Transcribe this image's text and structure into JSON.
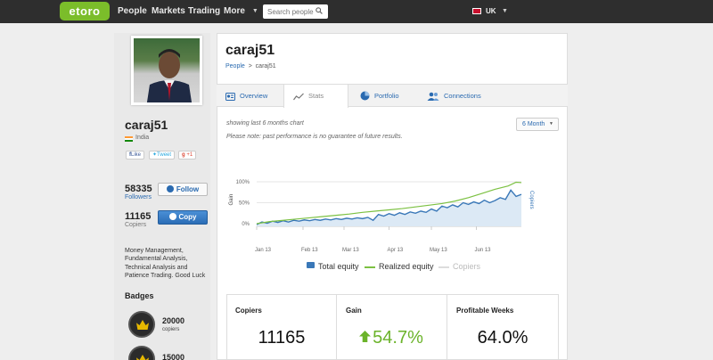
{
  "nav": {
    "logo": "etoro",
    "items": [
      "People",
      "Markets",
      "Trading",
      "More"
    ],
    "search_placeholder": "Search people",
    "language": "UK"
  },
  "profile": {
    "username": "caraj51",
    "country": "India",
    "social": {
      "facebook": "Like",
      "twitter": "Tweet",
      "gplus": "+1"
    },
    "followers_count": "58335",
    "followers_label": "Followers",
    "follow_label": "Follow",
    "copiers_count": "11165",
    "copiers_label": "Copiers",
    "copy_label": "Copy",
    "bio": "Money Management, Fundamental Analysis, Technical Analysis and Patience Trading. Good Luck",
    "badges_title": "Badges",
    "badges": [
      {
        "number": "20000",
        "label": "copiers"
      },
      {
        "number": "15000",
        "label": ""
      }
    ]
  },
  "main": {
    "title": "caraj51",
    "breadcrumb": {
      "root": "People",
      "sep": ">",
      "current": "caraj51"
    },
    "tabs": [
      "Overview",
      "Stats",
      "Portfolio",
      "Connections"
    ],
    "active_tab": "Stats",
    "note_period": "showing last 6 months chart",
    "note_disclaimer": "Please note: past performance is no guarantee of future results.",
    "period_select": "6 Month"
  },
  "chart_data": {
    "type": "line",
    "ylabel": "Gain",
    "y2label": "Copiers",
    "x_ticks": [
      "Jan 13",
      "Feb 13",
      "Mar 13",
      "Apr 13",
      "May 13",
      "Jun 13"
    ],
    "y_ticks": [
      "0%",
      "50%",
      "100%"
    ],
    "ylim": [
      0,
      100
    ],
    "legend_position": "bottom",
    "series": [
      {
        "name": "Total equity",
        "color": "#3a78b8",
        "style": "area",
        "x": [
          0,
          2,
          4,
          6,
          8,
          10,
          12,
          14,
          16,
          18,
          20,
          22,
          24,
          26,
          28,
          30,
          32,
          34,
          36,
          38,
          40,
          42,
          44,
          46,
          48,
          50,
          52,
          54,
          56,
          58,
          60,
          62,
          64,
          66,
          68,
          70,
          72,
          74,
          76,
          78,
          80,
          82,
          84,
          86,
          88,
          90,
          92,
          94,
          96,
          98,
          100
        ],
        "values": [
          -2,
          4,
          1,
          6,
          3,
          7,
          4,
          8,
          6,
          9,
          7,
          10,
          8,
          11,
          9,
          12,
          10,
          13,
          11,
          14,
          12,
          15,
          8,
          22,
          18,
          24,
          20,
          26,
          22,
          28,
          25,
          30,
          27,
          35,
          30,
          42,
          38,
          45,
          40,
          50,
          46,
          52,
          48,
          56,
          50,
          55,
          62,
          58,
          80,
          65,
          70
        ]
      },
      {
        "name": "Realized equity",
        "color": "#7cc142",
        "style": "line",
        "x": [
          0,
          5,
          10,
          15,
          20,
          25,
          30,
          35,
          40,
          45,
          50,
          55,
          60,
          65,
          70,
          75,
          80,
          85,
          90,
          95,
          98,
          100
        ],
        "values": [
          0,
          5,
          8,
          11,
          14,
          17,
          20,
          23,
          27,
          30,
          33,
          36,
          40,
          44,
          48,
          54,
          62,
          72,
          82,
          90,
          99,
          98
        ]
      },
      {
        "name": "Copiers",
        "color": "#cccccc",
        "style": "line",
        "x": [],
        "values": []
      }
    ]
  },
  "cards": [
    {
      "title": "Copiers",
      "value": "11165",
      "trend": ""
    },
    {
      "title": "Gain",
      "value": "54.7%",
      "trend": "up"
    },
    {
      "title": "Profitable Weeks",
      "value": "64.0%",
      "trend": ""
    }
  ],
  "colors": {
    "accent": "#2a6ab0",
    "brand": "#7bbd2a",
    "positive": "#6bb32a"
  }
}
